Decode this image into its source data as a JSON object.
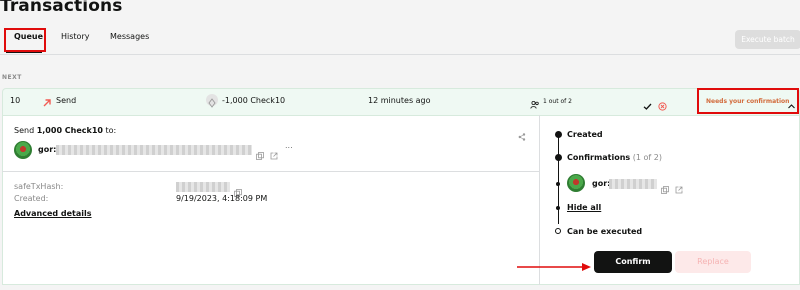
{
  "page": {
    "title": "Transactions"
  },
  "tabs": [
    {
      "label": "Queue"
    },
    {
      "label": "History"
    },
    {
      "label": "Messages"
    }
  ],
  "toolbar": {
    "execute_batch_label": "Execute batch"
  },
  "queue": {
    "section_label": "NEXT"
  },
  "transaction": {
    "nonce": "10",
    "type_label": "Send",
    "amount": "-1,000 Check10",
    "time": "12 minutes ago",
    "confirmations": "1 out of 2",
    "status": "Needs your confirmation"
  },
  "details": {
    "send_prefix": "Send ",
    "send_amount": "1,000 Check10",
    "send_suffix": " to:",
    "recipient_prefix": "gor:",
    "safe_tx_hash_label": "safeTxHash:",
    "created_label": "Created:",
    "created_value": "9/19/2023, 4:18:09 PM",
    "advanced_details_label": "Advanced details",
    "more_label": "..."
  },
  "timeline": {
    "created": "Created",
    "confirmations": "Confirmations",
    "confirmations_count": "(1 of 2)",
    "signer_prefix": "gor:",
    "hide_all": "Hide all",
    "can_be_executed": "Can be executed"
  },
  "actions": {
    "confirm_label": "Confirm",
    "replace_label": "Replace"
  },
  "colors": {
    "accent": "#121312",
    "highlight_red": "#e00b0b",
    "row_bg": "#eff9f3",
    "status_orange": "#d26a3b",
    "error": "#f25c54"
  }
}
